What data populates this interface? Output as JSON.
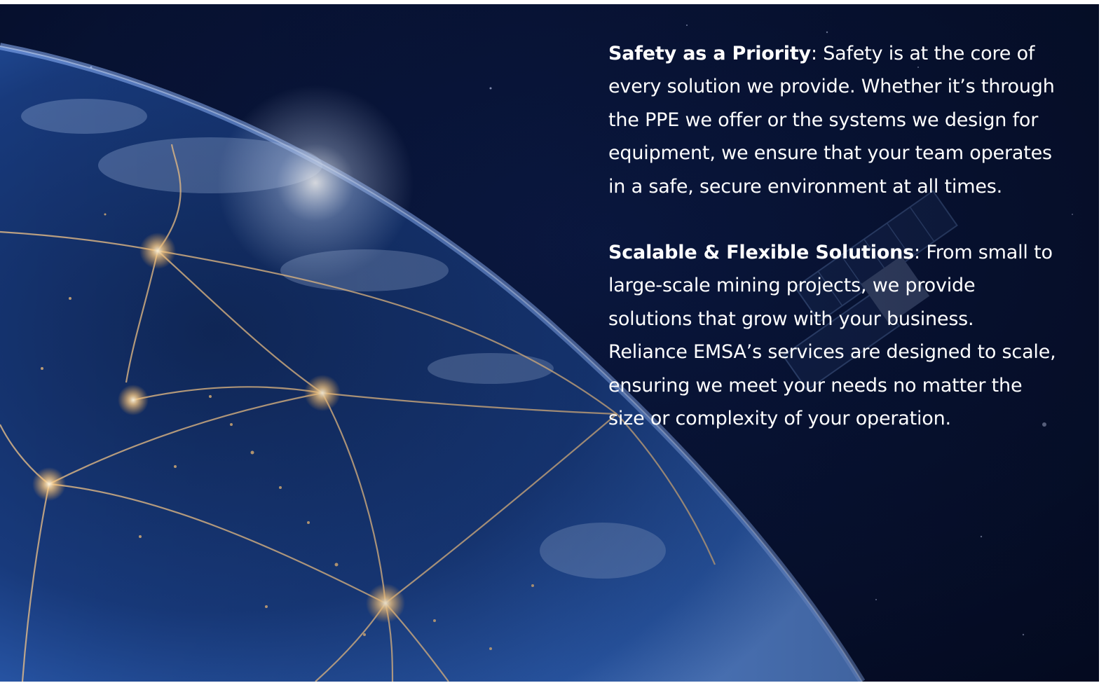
{
  "features": [
    {
      "title": "Safety as a Priority",
      "separator": ":",
      "body": " Safety is at the core of every solution we provide. Whether it’s through the PPE we offer or the systems we design for equipment, we ensure that your team operates in a safe, secure environment at all times."
    },
    {
      "title": "Scalable & Flexible Solutions",
      "separator": ":",
      "body": " From small to large-scale mining projects, we provide solutions that grow with your business. Reliance EMSA’s services are designed to scale, ensuring we meet your needs no matter the size or complexity of your operation."
    }
  ],
  "background": {
    "image": "earth-from-space-network-illustration",
    "colors": {
      "space": "#050b22",
      "earth": "#1d3f86",
      "city_lights": "#f5c27a"
    }
  }
}
